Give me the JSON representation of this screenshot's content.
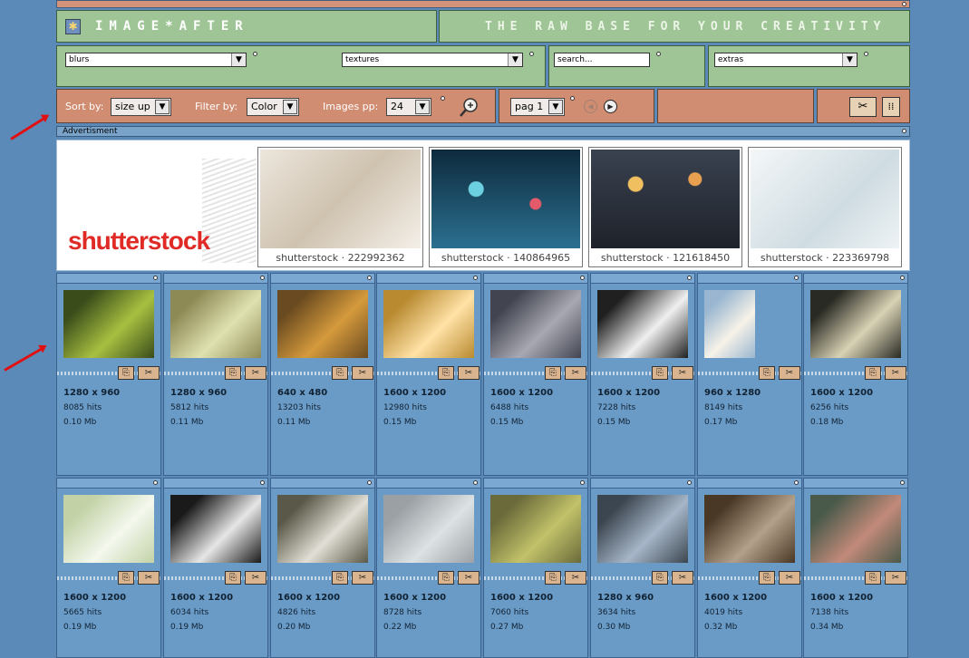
{
  "header": {
    "logo_text": "IMAGE*AFTER",
    "tagline": "THE RAW BASE FOR YOUR CREATIVITY"
  },
  "category_selects": [
    {
      "value": "blurs"
    },
    {
      "value": "textures"
    },
    {
      "value": "extras"
    }
  ],
  "search": {
    "value": "search..."
  },
  "toolbar": {
    "sort_label": "Sort by:",
    "sort_value": "size up",
    "filter_label": "Filter by:",
    "filter_value": "Color",
    "images_pp_label": "Images pp:",
    "images_pp_value": "24",
    "page_value": "pag 1"
  },
  "ad": {
    "label": "Advertisment",
    "brand": "shutterstock",
    "images": [
      {
        "caption": "shutterstock · 222992362",
        "color": "#e9e2d8"
      },
      {
        "caption": "shutterstock · 140864965",
        "color": "#1f4c68"
      },
      {
        "caption": "shutterstock · 121618450",
        "color": "#40485a"
      },
      {
        "caption": "shutterstock · 223369798",
        "color": "#e2ebef"
      }
    ]
  },
  "images": [
    {
      "res": "1280 x 960",
      "hits": "8085 hits",
      "size": "0.10 Mb",
      "color": "#3a4c1a",
      "accent": "#a8c040"
    },
    {
      "res": "1280 x 960",
      "hits": "5812 hits",
      "size": "0.11 Mb",
      "color": "#8e8a56",
      "accent": "#dfe2b0"
    },
    {
      "res": "640 x 480",
      "hits": "13203 hits",
      "size": "0.11 Mb",
      "color": "#6a4a20",
      "accent": "#d59a3c"
    },
    {
      "res": "1600 x 1200",
      "hits": "12980 hits",
      "size": "0.15 Mb",
      "color": "#b98a30",
      "accent": "#ffe2a6"
    },
    {
      "res": "1600 x 1200",
      "hits": "6488 hits",
      "size": "0.15 Mb",
      "color": "#424550",
      "accent": "#a8a8b2"
    },
    {
      "res": "1600 x 1200",
      "hits": "7228 hits",
      "size": "0.15 Mb",
      "color": "#202020",
      "accent": "#f0f0f0"
    },
    {
      "res": "960 x 1280",
      "hits": "8149 hits",
      "size": "0.17 Mb",
      "color": "#9ab6d0",
      "accent": "#f6f2e8"
    },
    {
      "res": "1600 x 1200",
      "hits": "6256 hits",
      "size": "0.18 Mb",
      "color": "#2a2a24",
      "accent": "#d8d2b4"
    },
    {
      "res": "1600 x 1200",
      "hits": "5665 hits",
      "size": "0.19 Mb",
      "color": "#c2d2a6",
      "accent": "#f4f8ee"
    },
    {
      "res": "1600 x 1200",
      "hits": "6034 hits",
      "size": "0.19 Mb",
      "color": "#1a1a1a",
      "accent": "#e6e6e6"
    },
    {
      "res": "1600 x 1200",
      "hits": "4826 hits",
      "size": "0.20 Mb",
      "color": "#5a5848",
      "accent": "#e2e0d6"
    },
    {
      "res": "1600 x 1200",
      "hits": "8728 hits",
      "size": "0.22 Mb",
      "color": "#9aa0a4",
      "accent": "#dde2e4"
    },
    {
      "res": "1600 x 1200",
      "hits": "7060 hits",
      "size": "0.27 Mb",
      "color": "#6a6a3a",
      "accent": "#c2c26a"
    },
    {
      "res": "1280 x 960",
      "hits": "3634 hits",
      "size": "0.30 Mb",
      "color": "#3c4650",
      "accent": "#a6b6c8"
    },
    {
      "res": "1600 x 1200",
      "hits": "4019 hits",
      "size": "0.32 Mb",
      "color": "#4a3826",
      "accent": "#b2a08a"
    },
    {
      "res": "1600 x 1200",
      "hits": "7138 hits",
      "size": "0.34 Mb",
      "color": "#4a5a4a",
      "accent": "#c28a7a"
    }
  ]
}
